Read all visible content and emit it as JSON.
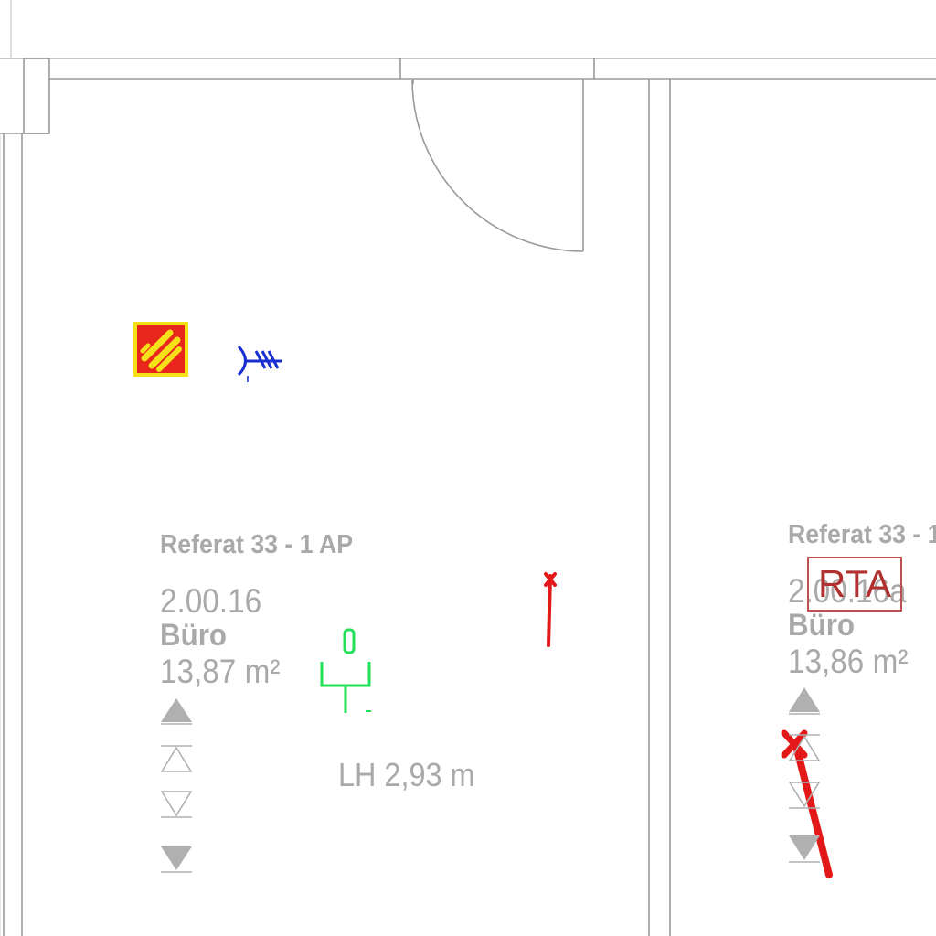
{
  "plan": {
    "rooms": [
      {
        "id": "left",
        "department": "Referat 33 -  1 AP",
        "number": "2.00.16",
        "name": "Büro",
        "area": "13,87 m²",
        "clear_height": "LH 2,93 m"
      },
      {
        "id": "right",
        "department": "Referat 33 -  1",
        "number": "2.00.16a",
        "name": "Büro",
        "area": "13,86 m²"
      }
    ],
    "tag": {
      "label": "RTA"
    },
    "symbols": {
      "fire_alarm_icon": "fire-extinguisher-sign-icon",
      "antenna_icon": "antenna-symbol-icon",
      "outlet_icon": "network-outlet-icon",
      "level_icons": [
        "level-marker-up-filled-icon",
        "level-marker-up-outline-icon",
        "level-marker-down-outline-icon",
        "level-marker-down-filled-icon"
      ]
    },
    "colors": {
      "wall": "#9a9a9a",
      "label": "#a9a9a9",
      "fire_sign_fill": "#e8261c",
      "fire_sign_border": "#f5e11a",
      "antenna": "#1a2fd0",
      "outlet": "#22e05a",
      "markup_red": "#e31818"
    }
  }
}
